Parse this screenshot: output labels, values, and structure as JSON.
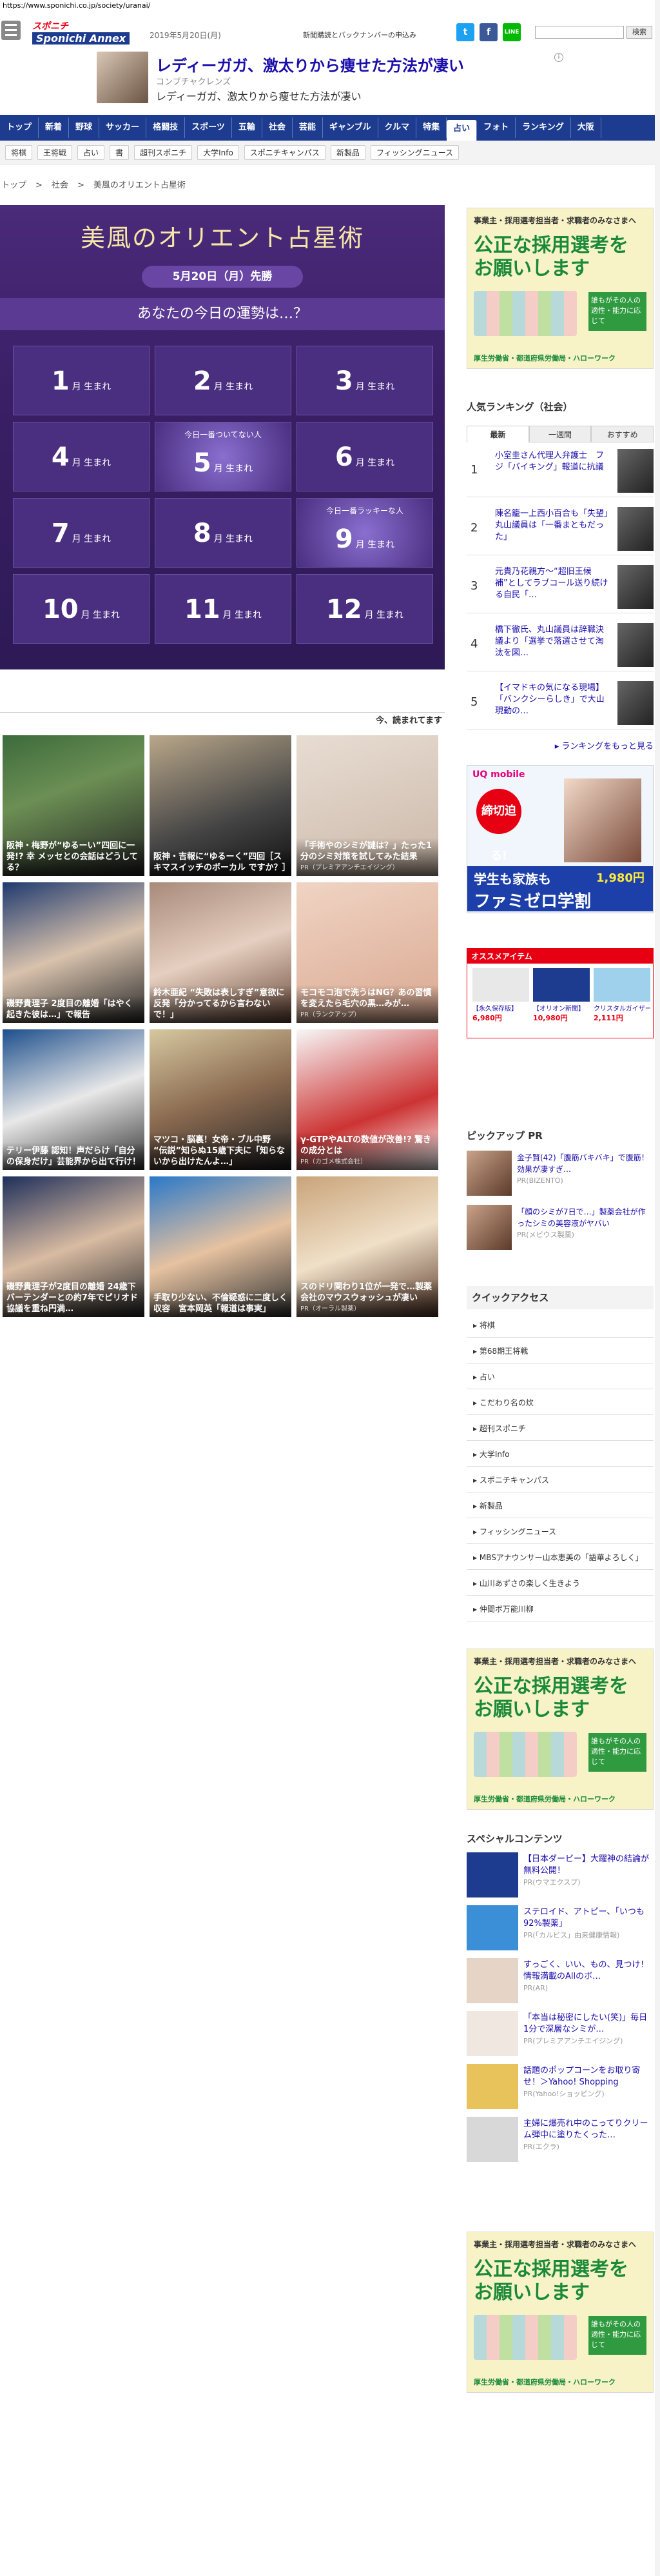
{
  "url": "https://www.sponichi.co.jp/society/uranai/",
  "header": {
    "logo_top": "スポニチ",
    "logo_main": "Sponichi Annex",
    "date": "2019年5月20日(月)",
    "notice": "新聞購読とバックナンバーの申込み",
    "search_placeholder": "",
    "search_button": "検索",
    "twitter": "t",
    "facebook": "f",
    "line": "LINE"
  },
  "top_ad": {
    "title": "レディーガガ、激太りから痩せた方法が凄い",
    "sponsor": "コンブチャクレンズ",
    "desc": "レディーガガ、激太りから痩せた方法が凄い",
    "info": "i"
  },
  "nav": [
    "トップ",
    "新着",
    "野球",
    "サッカー",
    "格闘技",
    "スポーツ",
    "五輪",
    "社会",
    "芸能",
    "ギャンブル",
    "クルマ",
    "特集",
    "占い",
    "フォト",
    "ランキング",
    "大阪"
  ],
  "nav_active": "占い",
  "subnav": [
    "将棋",
    "王将戦",
    "占い",
    "書",
    "超刊スポニチ",
    "大学Info",
    "スポニチキャンパス",
    "新製品",
    "フィッシングニュース"
  ],
  "breadcrumb": [
    "トップ",
    ">",
    "社会",
    ">",
    "美風のオリエント占星術"
  ],
  "hero": {
    "title": "美風のオリエント占星術",
    "date": "5月20日（月）先勝",
    "question": "あなたの今日の運勢は…？",
    "suffix": "月 生まれ",
    "months": [
      "1",
      "2",
      "3",
      "4",
      "5",
      "6",
      "7",
      "8",
      "9",
      "10",
      "11",
      "12"
    ],
    "badge_unlucky": "今日一番ついてない人",
    "badge_lucky": "今日一番ラッキーな人"
  },
  "ranking_head": "今、読まれてます",
  "cards": [
    {
      "text": "阪神・梅野が“ゆるーい”四回に一発!? 幸 メッセとの会話はどうしてる？",
      "pr": ""
    },
    {
      "text": "阪神・吉報に“ゆるーく”四回［スキマスイッチのボーカル ですか？］",
      "pr": ""
    },
    {
      "text": "「手術やのシミが謎は？」たった1分のシミ対策を試してみた結果",
      "pr": "PR（プレミアアンチエイジング）"
    },
    {
      "text": "磯野貴理子 2度目の離婚「はやく起きた彼は…」で報告",
      "pr": ""
    },
    {
      "text": "鈴木亜紀 “失敗は表しすぎ”意欲に反発「分かってるから言わないで！」",
      "pr": ""
    },
    {
      "text": "モコモコ泡で洗うはNG？あの習慣を変えたら毛穴の黒…みが…",
      "pr": "PR（ランクアップ）"
    },
    {
      "text": "テリー伊藤 認知！声だらけ「自分の保身だけ」芸能界から出て行け！",
      "pr": ""
    },
    {
      "text": "マツコ・脳裏！女帝・ブル中野 “伝説”知らぬ15歳下夫に「知らないから出けたんよ…」",
      "pr": ""
    },
    {
      "text": "γ-GTPやALTの数値が改善!? 驚きの成分とは",
      "pr": "PR（カゴメ株式会社）"
    },
    {
      "text": "磯野貴理子が2度目の離婚 24歳下バーテンダーとの約7年でピリオド　協議を重ね円満…",
      "pr": ""
    },
    {
      "text": "手取り少ない、不倫疑惑に二度しく収容　宮本岡英「報道は事実」",
      "pr": ""
    },
    {
      "text": "スのドリ関わり1位が一発で…製薬会社のマウスウォッシュが凄い",
      "pr": "PR（オーラル製薬）"
    }
  ],
  "sidebar": {
    "banner": {
      "t1": "事業主・採用選考担当者・求職者のみなさまへ",
      "t2": "公正な採用選考を お願いします",
      "note": "誰もがその人の適性・能力に応じて",
      "foot": "厚生労働省・都道府県労働局・ハローワーク"
    },
    "ranking_title": "人気ランキング（社会）",
    "tabs": [
      "最新",
      "一週間",
      "おすすめ"
    ],
    "ranking": [
      {
        "n": "1",
        "t": "小室圭さん代理人弁護士　フジ「バイキング」報道に抗議"
      },
      {
        "n": "2",
        "t": "陳名籠一上西小百合も「失望」　丸山議員は「一番まともだった」"
      },
      {
        "n": "3",
        "t": "元貴乃花親方〜“超旧王候補”としてラブコール送り続ける自民「…"
      },
      {
        "n": "4",
        "t": "橋下徹氏、丸山議員は辞職決議より「選挙で落選させて淘汰を図…"
      },
      {
        "n": "5",
        "t": "【イマドキの気になる現場】「バンクシーらしき」で大山現勤の…"
      }
    ],
    "ranking_more": "▸ ランキングをもっと見る",
    "liq": {
      "brand": "UQ mobile",
      "line1": "締切迫る!",
      "line2": "学生も家族も",
      "line3": "ファミゼロ学割",
      "price": "1,980円"
    },
    "shop_head": "オススメアイテム",
    "shop_items": [
      "【永久保存版】",
      "【オリオン新聞】",
      "クリスタルガイザー"
    ],
    "shop_prices": [
      "6,980円",
      "10,980円",
      "2,111円"
    ],
    "pickup_title": "ピックアップ PR",
    "pickup": [
      {
        "t": "金子賢(42)「腹筋バキバキ」で腹筋！効果が凄すぎ…",
        "pr": "PR(BIZENTO)"
      },
      {
        "t": "「顔のシミが7日で…」製薬会社が作ったシミの美容液がヤバい",
        "pr": "PR(メビウス製薬)"
      }
    ],
    "quick_title": "クイックアクセス",
    "quick": [
      "将棋",
      "第68期王将戦",
      "占い",
      "こだわり名の炊",
      "超刊スポニチ",
      "大学Info",
      "スポニチキャンパス",
      "新製品",
      "フィッシングニュース",
      "MBSアナウンサー山本恵美の「語華よろしく」",
      "山川あずさの楽しく生きよう",
      "仲間ボ万能川柳"
    ],
    "special_title": "スペシャルコンテンツ",
    "special": [
      {
        "t": "【日本ダービー】大躍神の結論が無料公開！",
        "pr": "PR(ウマエクスプ)"
      },
      {
        "t": "ステロイド、アトピー、「いつも92%製薬」",
        "pr": "PR(「カルビス」由来健康情報)"
      },
      {
        "t": "すっごく、いい、もの、見つけ！情報満載のAllのボ…",
        "pr": "PR(AR)"
      },
      {
        "t": "「本当は秘密にしたい(笑)」毎日1分で深層なシミが…",
        "pr": "PR(プレミアアンチエイジング)"
      },
      {
        "t": "話題のポップコーンをお取り寄せ！＞Yahoo! Shopping",
        "pr": "PR(Yahoo!ショッピング)"
      },
      {
        "t": "主婦に爆売れ中のこってりクリーム弾中に塗りたくった…",
        "pr": "PR(エクラ)"
      }
    ]
  }
}
